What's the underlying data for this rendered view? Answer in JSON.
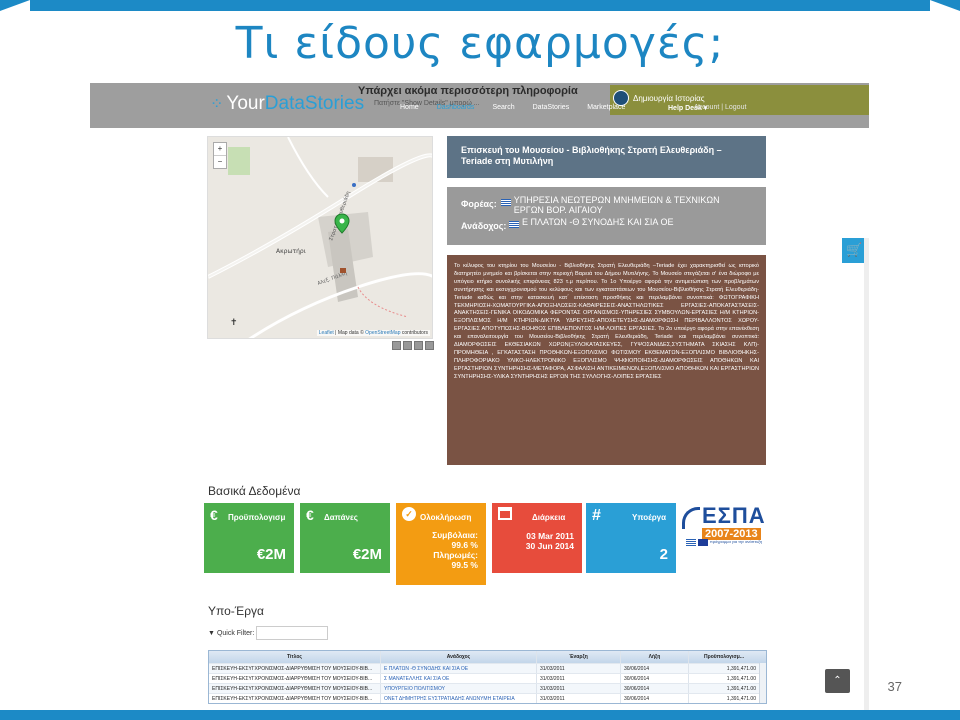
{
  "slide": {
    "title": "Τι είδους εφαρμογές;",
    "page_number": "37"
  },
  "site": {
    "logo_text_1": "Your",
    "logo_text_2": "DataStories",
    "overlay_title": "Υπάρχει ακόμα περισσότερη πληροφορία",
    "overlay_sub": "Πατήστε \"Show Details\" μπορώ ...",
    "nav": [
      "Home",
      "Dashboards",
      "Search",
      "DataStories",
      "Marketplace"
    ],
    "story_button": "Δημιουργία Ιστορίας",
    "help_desk": "Help Desk ▾",
    "account": "Account | Logout"
  },
  "map": {
    "zoom_in": "+",
    "zoom_out": "−",
    "label_akrotiri": "Ακρωτήρι",
    "label_road": "Στρατή Ελευθεριάδη",
    "attribution_leaflet": "Leaflet",
    "attribution_mid": " | Map data © ",
    "attribution_osm": "OpenStreetMap",
    "attribution_end": " contributors"
  },
  "project": {
    "title": "Επισκευή του Μουσείου - Βιβλιοθήκης Στρατή Ελευθεριάδη –Teriade στη Μυτιλήνη",
    "body_label": "Φορέας:",
    "body_value": "ΥΠΗΡΕΣΙΑ ΝΕΩΤΕΡΩΝ ΜΝΗΜΕΙΩΝ & ΤΕΧΝΙΚΩΝ ΕΡΓΩΝ ΒΟΡ. ΑΙΓΑΙΟΥ",
    "contractor_label": "Ανάδοχος:",
    "contractor_value": "Ε ΠΛΑΤΩΝ -Θ ΣΥΝΟΔΗΣ ΚΑΙ ΣΙΑ ΟΕ",
    "description": "Το κέλυφος του κτηρίου του Μουσείου - Βιβλιοθήκης Στρατή Ελευθεριάδη –Teriade έχει χαρακτηρισθεί ως ιστορικό διατηρητέο μνημείο και βρίσκεται στην περιοχή Βαρειά του Δήμου Μυτιλήνης. Το Μουσείο στεγάζεται σ' ένα διώροφο με υπόγειο κτήριο συνολικής επιφάνειας 823 τ.μ περίπου. Το 1ο Υποέργο αφορά την αντιμετώπιση των προβλημάτων συντήρησης και εκσυγχρονισμού του κελύφους και των εγκαταστάσεων του Μουσείου-Βιβλιοθήκης Στρατή Ελευθεριάδη-Teriade καθώς και στην κατασκευή κατ΄ επέκταση προσθήκης και περιλαμβάνει συνοπτικά: ΦΩΤΟΓΡΑΦΙΚΗ ΤΕΚΜΗΡΙΩΣΗ-ΧΩΜΑΤΟΥΡΓΙΚΑ-ΑΠΟΞΗΛΩΣΕΙΣ-ΚΑΘΑΙΡΕΣΕΙΣ-ΑΝΑΣΤΗΛΩΤΙΚΕΣ ΕΡΓΑΣΙΕΣ-ΑΠΟΚΑΤΑΣΤΑΣΕΙΣ-ΑΝΑΚΤΗΣΕΙΣ-ΓΕΝΙΚΑ ΟΙΚΟΔΟΜΙΚΑ ΦΕΡΟΝΤΑΣ ΟΡΓΑΝΙΣΜΟΣ-ΥΠΗΡΕΣΙΕΣ ΣΥΜΒΟΥΛΩΝ-ΕΡΓΑΣΙΕΣ Η/Μ ΚΤΗΡΙΩΝ-ΕΞΟΠΛΙΣΜΟΣ Η/Μ ΚΤΗΡΙΩΝ-ΔΙΚΤΥΑ ΥΔΡΕΥΣΗΣ-ΑΠΟΧΕΤΕΥΣΗΣ-ΔΙΑΜΟΡΦΩΣΗ ΠΕΡΙΒΑΛΛΟΝΤΟΣ ΧΩΡΟΥ-ΕΡΓΑΣΙΕΣ ΑΠΟΤΥΠΩΣΗΣ-ΒΟΗΘΟΣ ΕΠΙΒΛΕΠΟΝΤΟΣ Η/Μ-ΛΟΙΠΕΣ ΕΡΓΑΣΙΕΣ. Το 2ο υποέργο αφορά στην επανέκθεση και επαναλειτουργία του Μουσείου-Βιβλιοθήκης Στρατή Ελευθεριάδη, Teriade και περιλαμβάνει συνοπτικά: ΔΙΑΜΟΡΦΩΣΕΙΣ ΕΚΘΕΣΙΑΚΩΝ ΧΩΡΩΝ(ΞΥΛΟΚΑΤΑΣΚΕΥΕΣ, ΓΥΨΟΣΑΝΙΔΕΣ,ΣΥΣΤΗΜΑΤΑ ΣΚΙΑΣΗΣ ΚΛΠ)-ΠΡΟΜΗΘΕΙΑ , ΕΓΚΑΤΑΣΤΑΣΗ ΠΡΟΘΗΚΩΝ-ΕΞΟΠΛΙΣΜΟ ΦΩΤΙΣΜΟΥ ΕΚΘΕΜΑΤΩΝ-ΕΞΟΠΛΙΣΜΟ ΒΙΒΛΙΟΘΗΚΗΣ-ΠΛΗΡΟΦΟΡΙΑΚΟ ΥΛΙΚΟ-ΗΛΕΚΤΡΟΝΙΚΟ ΕΞΟΠΛΙΣΜΟ ΨΗΦΙΟΠΟΙΗΣΗΣ-ΔΙΑΜΟΡΦΩΣΕΙΣ ΑΠΟΘΗΚΩΝ ΚΑΙ ΕΡΓΑΣΤΗΡΙΩΝ ΣΥΝΤΗΡΗΣΗΣ-ΜΕΤΑΦΟΡΑ, ΑΣΦΑΛΙΣΗ ΑΝΤΙΚΕΙΜΕΝΩΝ,ΕΞΟΠΛΙΣΜΟ ΑΠΟΘΗΚΩΝ ΚΑΙ ΕΡΓΑΣΤΗΡΙΩΝ ΣΥΝΤΗΡΗΣΗΣ-ΥΛΙΚΑ ΣΥΝΤΗΡΗΣΗΣ ΕΡΓΩΝ ΤΗΣ ΣΥΛΛΟΓΗΣ-ΛΟΙΠΕΣ ΕΡΓΑΣΙΕΣ"
  },
  "basic_data": {
    "heading": "Βασικά Δεδομένα",
    "tiles": [
      {
        "label": "Προϋπολογισμ",
        "value": "€2M",
        "icon": "€",
        "color": "#4cae4c"
      },
      {
        "label": "Δαπάνες",
        "value": "€2M",
        "icon": "€",
        "color": "#4cae4c"
      },
      {
        "label": "Ολοκλήρωση",
        "icon": "check-icon",
        "line1": "Συμβόλαια:",
        "line2": "99.6 %",
        "line3": "Πληρωμές:",
        "line4": "99.5 %",
        "color": "#f39c12"
      },
      {
        "label": "Διάρκεια",
        "icon": "calendar-icon",
        "line1": "03 Mar 2011",
        "line2": "30 Jun 2014",
        "color": "#e74c3c"
      },
      {
        "label": "Υποέργα",
        "value": "2",
        "icon": "#",
        "color": "#2a9fd6"
      }
    ],
    "espa_title": "ΕΣΠΑ",
    "espa_years": "2007-2013",
    "espa_sub": "πρόγραμμα για την ανάπτυξη"
  },
  "subprojects": {
    "heading": "Υπο-Έργα",
    "quick_filter_label": "Quick Filter:",
    "quick_filter_value": "",
    "columns": [
      "Τίτλος",
      "Ανάδοχος",
      "Έναρξη",
      "Λήξη",
      "Προϋπολογισμ..."
    ],
    "rows": [
      [
        "ΕΠΙΣΚΕΥΗ-ΕΚΣΥΓΧΡΟΝΙΣΜΟΣ-ΔΙΑΡΡΥΘΜΙΣΗ ΤΟΥ ΜΟΥΣΕΙΟΥ-ΒΙΒ...",
        "Ε ΠΛΑΤΩΝ -Θ ΣΥΝΟΔΗΣ ΚΑΙ ΣΙΑ ΟΕ",
        "31/03/2011",
        "30/06/2014",
        "1,391,471.00"
      ],
      [
        "ΕΠΙΣΚΕΥΗ-ΕΚΣΥΓΧΡΟΝΙΣΜΟΣ-ΔΙΑΡΡΥΘΜΙΣΗ ΤΟΥ ΜΟΥΣΕΙΟΥ-ΒΙΒ...",
        "Σ ΜΑΝΑΤΕΛΛΗΣ ΚΑΙ ΣΙΑ ΟΕ",
        "31/03/2011",
        "30/06/2014",
        "1,391,471.00"
      ],
      [
        "ΕΠΙΣΚΕΥΗ-ΕΚΣΥΓΧΡΟΝΙΣΜΟΣ-ΔΙΑΡΡΥΘΜΙΣΗ ΤΟΥ ΜΟΥΣΕΙΟΥ-ΒΙΒ...",
        "ΥΠΟΥΡΓΕΙΟ ΠΟΛΙΤΙΣΜΟΥ",
        "31/03/2011",
        "30/06/2014",
        "1,391,471.00"
      ],
      [
        "ΕΠΙΣΚΕΥΗ-ΕΚΣΥΓΧΡΟΝΙΣΜΟΣ-ΔΙΑΡΡΥΘΜΙΣΗ ΤΟΥ ΜΟΥΣΕΙΟΥ-ΒΙΒ...",
        "ΟΝΕΤ ΔΗΜΗΤΡΗΣ ΕΥΣΤΡΑΤΙΑΔΗΣ ΑΝΩΝΥΜΗ ΕΤΑΙΡΕΙΑ",
        "31/03/2011",
        "30/06/2014",
        "1,391,471.00"
      ]
    ]
  }
}
